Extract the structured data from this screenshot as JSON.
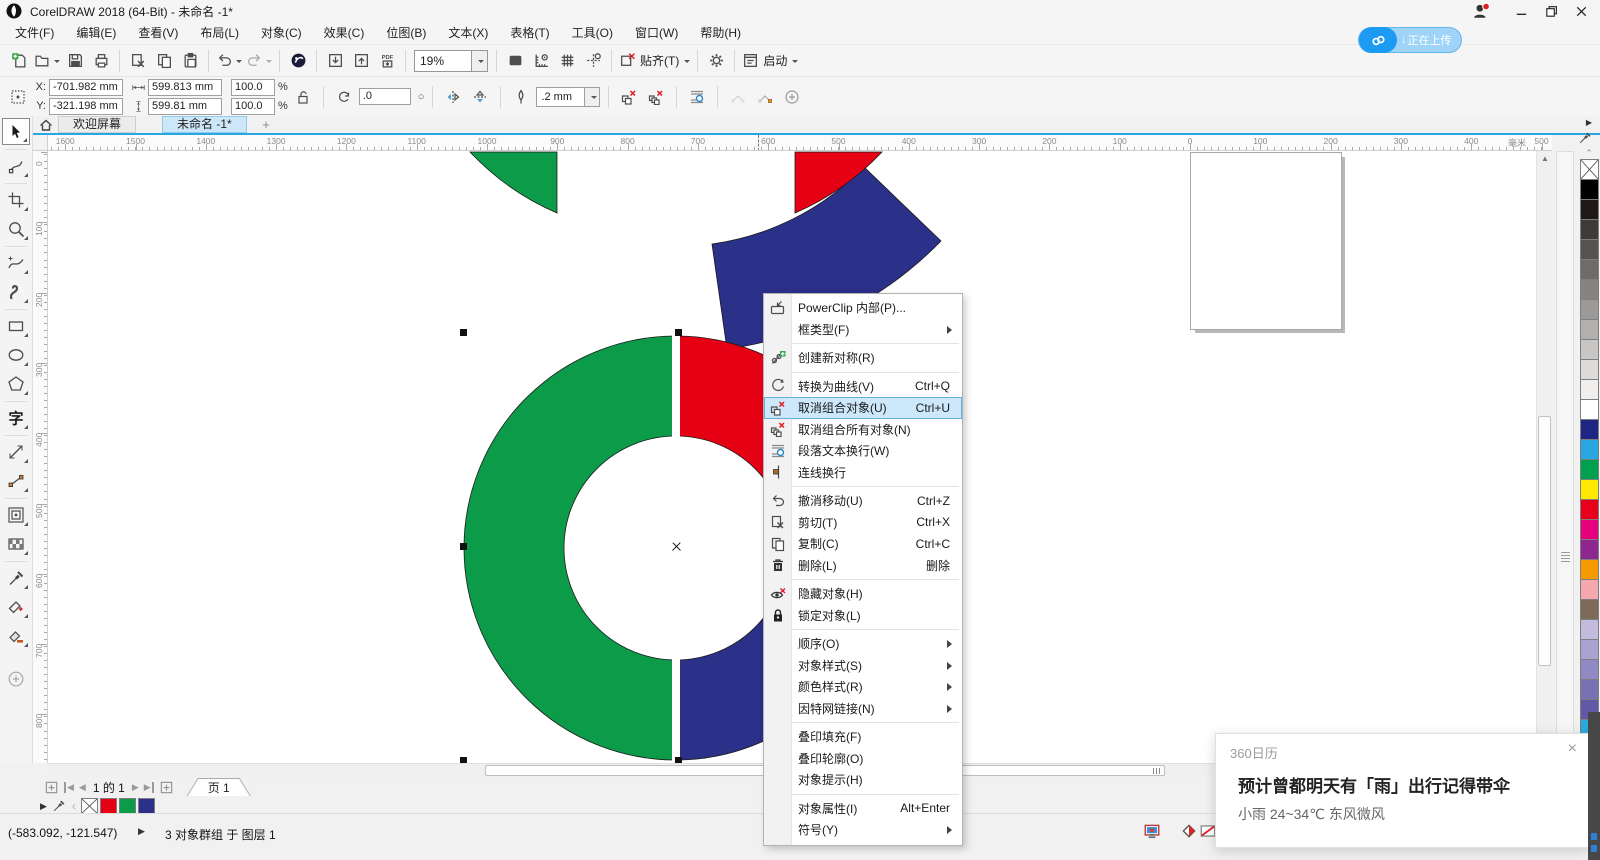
{
  "window": {
    "title": "CorelDRAW 2018 (64-Bit) - 未命名 -1*"
  },
  "menubar": [
    "文件(F)",
    "编辑(E)",
    "查看(V)",
    "布局(L)",
    "对象(C)",
    "效果(C)",
    "位图(B)",
    "文本(X)",
    "表格(T)",
    "工具(O)",
    "窗口(W)",
    "帮助(H)"
  ],
  "toolbar": {
    "zoom": "19%",
    "snap": "贴齐(T)",
    "launch": "启动"
  },
  "netdisk": {
    "arrow": "↓",
    "label": "正在上传"
  },
  "propbar": {
    "x_label": "X:",
    "y_label": "Y:",
    "x": "-701.982 mm",
    "y": "-321.198 mm",
    "w": "599.813 mm",
    "h": "599.81 mm",
    "sx": "100.0",
    "sy": "100.0",
    "pct": "%",
    "angle": ".0",
    "angle_mark": "○",
    "outline": ".2 mm"
  },
  "tabbar": {
    "welcome": "欢迎屏幕",
    "doc": "未命名 -1*",
    "add": "+"
  },
  "ruler": {
    "unit": "毫米"
  },
  "canvas": {
    "green": "#0b9b49",
    "red": "#e60014",
    "blue": "#2b3088"
  },
  "context_menu": {
    "items": [
      {
        "icon": "powerclip-icon",
        "label": "PowerClip 内部(P)..."
      },
      {
        "label": "框类型(F)",
        "submenu": true,
        "sep": true
      },
      {
        "icon": "symmetry-icon",
        "label": "创建新对称(R)",
        "sep": true
      },
      {
        "icon": "to-curve-icon",
        "label": "转换为曲线(V)",
        "shortcut": "Ctrl+Q"
      },
      {
        "icon": "ungroup-icon",
        "label": "取消组合对象(U)",
        "shortcut": "Ctrl+U",
        "highlight": true
      },
      {
        "icon": "ungroup-all-icon",
        "label": "取消组合所有对象(N)"
      },
      {
        "icon": "text-wrap-icon",
        "label": "段落文本换行(W)"
      },
      {
        "icon": "connector-wrap-icon",
        "label": "连线换行",
        "sep": true
      },
      {
        "icon": "undo-icon",
        "label": "撤消移动(U)",
        "shortcut": "Ctrl+Z"
      },
      {
        "icon": "cut-icon",
        "label": "剪切(T)",
        "shortcut": "Ctrl+X"
      },
      {
        "icon": "copy-icon",
        "label": "复制(C)",
        "shortcut": "Ctrl+C"
      },
      {
        "icon": "delete-icon",
        "label": "删除(L)",
        "shortcut": "删除",
        "sep": true
      },
      {
        "icon": "hide-icon",
        "label": "隐藏对象(H)"
      },
      {
        "icon": "lock-icon",
        "label": "锁定对象(L)",
        "sep": true
      },
      {
        "label": "顺序(O)",
        "submenu": true
      },
      {
        "label": "对象样式(S)",
        "submenu": true
      },
      {
        "label": "颜色样式(R)",
        "submenu": true
      },
      {
        "label": "因特网链接(N)",
        "submenu": true,
        "sep": true
      },
      {
        "label": "叠印填充(F)"
      },
      {
        "label": "叠印轮廓(O)"
      },
      {
        "label": "对象提示(H)",
        "sep": true
      },
      {
        "label": "对象属性(I)",
        "shortcut": "Alt+Enter"
      },
      {
        "label": "符号(Y)",
        "submenu": true
      }
    ]
  },
  "pagenav": {
    "pos": "1 的 1",
    "tab": "页 1"
  },
  "doc_palette": [
    "#e60014",
    "#0b9b49",
    "#2b3088"
  ],
  "palette": [
    "#000000",
    "#1f1a17",
    "#3d3a38",
    "#565350",
    "#6e6b68",
    "#868381",
    "#9c9a98",
    "#b2b0ae",
    "#c7c6c4",
    "#dcdbda",
    "#f0efee",
    "#ffffff",
    "#1e2583",
    "#2aa7e0",
    "#00a04e",
    "#ffe900",
    "#e8001b",
    "#e5007d",
    "#8e268f",
    "#f59a00",
    "#f5a8b0",
    "#7e6a58",
    "#c3bbdd",
    "#aaa2cf",
    "#9189c1",
    "#7a71b3",
    "#6159a5",
    "#29abe2"
  ],
  "statusbar": {
    "coords": "(-583.092, -121.547)",
    "info": "3 对象群组 于 图层 1"
  },
  "popup": {
    "app": "360日历",
    "close": "×",
    "title": "预计曾都明天有「雨」出行记得带伞",
    "subtitle": "小雨 24~34℃ 东风微风"
  }
}
